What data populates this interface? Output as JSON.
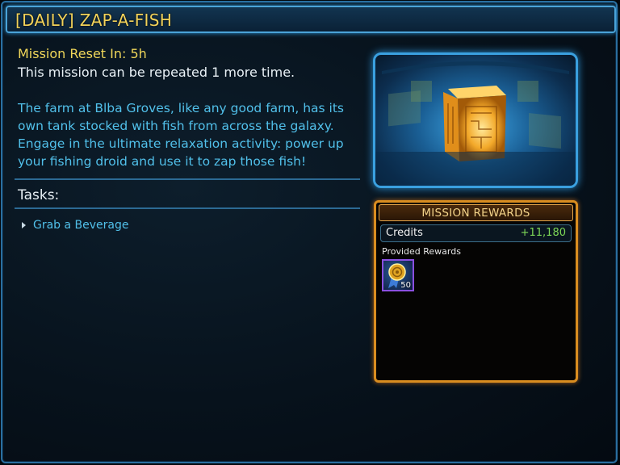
{
  "mission": {
    "title": "[DAILY] ZAP-A-FISH",
    "reset_text": "Mission Reset In: 5h",
    "repeat_text": "This mission can be repeated 1 more time.",
    "description": "The farm at Blba Groves, like any good farm, has its own tank stocked with fish from across the galaxy. Engage in the ultimate relaxation activity: power up your fishing droid and use it to zap those fish!"
  },
  "tasks": {
    "label": "Tasks:",
    "items": [
      "Grab a Beverage"
    ]
  },
  "rewards": {
    "header": "MISSION REWARDS",
    "credits_label": "Credits",
    "credits_value": "+11,180",
    "provided_label": "Provided Rewards",
    "items": [
      {
        "icon": "gold-medal-icon",
        "count": "50"
      }
    ]
  },
  "colors": {
    "title_gold": "#f3d35a",
    "text_cyan": "#51c0ea",
    "reward_orange": "#d98d20",
    "credits_green": "#7ed957"
  }
}
